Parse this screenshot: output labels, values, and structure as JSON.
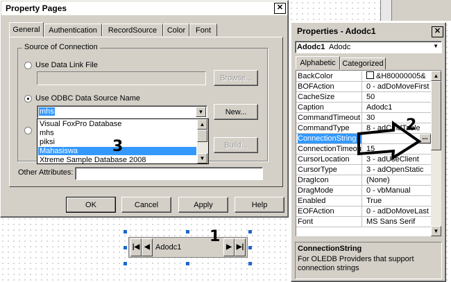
{
  "property_pages": {
    "title": "Property Pages",
    "tabs": [
      "General",
      "Authentication",
      "RecordSource",
      "Color",
      "Font"
    ],
    "active_tab": "General",
    "group_title": "Source of Connection",
    "use_data_link_label": "Use Data Link File",
    "data_link_value": "",
    "browse_label": "Browse...",
    "use_odbc_label": "Use ODBC Data Source Name",
    "odbc_value": "mhs",
    "new_label": "New...",
    "dropdown_options": [
      "Visual FoxPro Database",
      "mhs",
      "piksi",
      "Mahasiswa",
      "Xtreme Sample Database 2008"
    ],
    "dropdown_selected": "Mahasiswa",
    "build_label": "Build...",
    "other_attributes_label": "Other Attributes:",
    "other_attributes_value": "",
    "buttons": {
      "ok": "OK",
      "cancel": "Cancel",
      "apply": "Apply",
      "help": "Help"
    }
  },
  "properties": {
    "title": "Properties - Adodc1",
    "object_name": "Adodc1",
    "object_type": "Adodc",
    "tabs": [
      "Alphabetic",
      "Categorized"
    ],
    "active_tab": "Alphabetic",
    "rows": [
      {
        "name": "BackColor",
        "value": "&H80000005&"
      },
      {
        "name": "BOFAction",
        "value": "0 - adDoMoveFirst"
      },
      {
        "name": "CacheSize",
        "value": "50"
      },
      {
        "name": "Caption",
        "value": "Adodc1"
      },
      {
        "name": "CommandTimeout",
        "value": "30"
      },
      {
        "name": "CommandType",
        "value": "8 - adCmdTable"
      },
      {
        "name": "ConnectionString",
        "value": ""
      },
      {
        "name": "ConnectionTimeout",
        "value": "15"
      },
      {
        "name": "CursorLocation",
        "value": "3 - adUseClient"
      },
      {
        "name": "CursorType",
        "value": "3 - adOpenStatic"
      },
      {
        "name": "DragIcon",
        "value": "(None)"
      },
      {
        "name": "DragMode",
        "value": "0 - vbManual"
      },
      {
        "name": "Enabled",
        "value": "True"
      },
      {
        "name": "EOFAction",
        "value": "0 - adDoMoveLast"
      },
      {
        "name": "Font",
        "value": "MS Sans Serif"
      }
    ],
    "selected_row": "ConnectionString",
    "ellipsis": "...",
    "desc_title": "ConnectionString",
    "desc_text": "For OLEDB Providers that support connection strings"
  },
  "adodc_control": {
    "caption": "Adodc1"
  },
  "annotations": {
    "one": "1",
    "two": "2",
    "three": "3"
  },
  "colors": {
    "selection": "#3399ff",
    "face": "#d4d0c8",
    "handle": "#1e66d0"
  }
}
